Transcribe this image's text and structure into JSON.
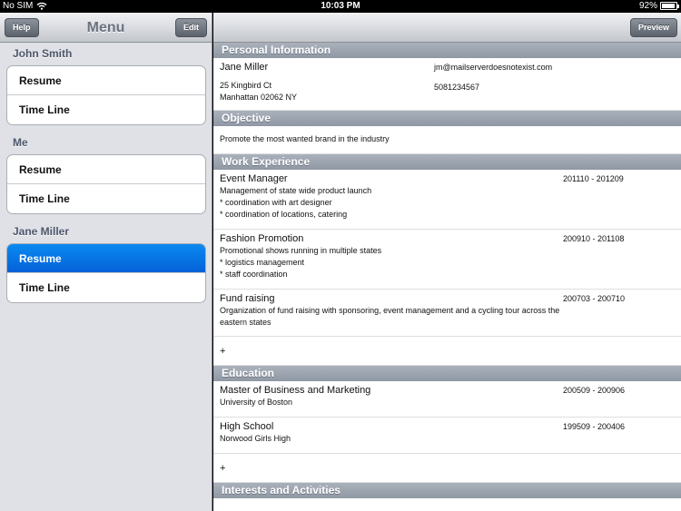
{
  "status_bar": {
    "carrier": "No SIM",
    "time": "10:03 PM",
    "battery": "92%",
    "battery_level": 0.92
  },
  "sidebar": {
    "title": "Menu",
    "help_label": "Help",
    "edit_label": "Edit",
    "groups": [
      {
        "name": "John Smith",
        "items": [
          {
            "label": "Resume"
          },
          {
            "label": "Time Line"
          }
        ]
      },
      {
        "name": "Me",
        "items": [
          {
            "label": "Resume"
          },
          {
            "label": "Time Line"
          }
        ]
      },
      {
        "name": "Jane Miller",
        "items": [
          {
            "label": "Resume"
          },
          {
            "label": "Time Line"
          }
        ]
      }
    ],
    "selected": "Jane Miller / Resume"
  },
  "detail": {
    "preview_label": "Preview",
    "personal": {
      "header": "Personal Information",
      "name": "Jane Miller",
      "email": "jm@mailserverdoesnotexist.com",
      "address1": "25 Kingbird Ct",
      "address2": "Manhattan 02062 NY",
      "phone": "5081234567"
    },
    "objective": {
      "header": "Objective",
      "text": "Promote the most wanted brand in the industry"
    },
    "work": {
      "header": "Work Experience",
      "items": [
        {
          "title": "Event Manager",
          "dates": "201110 - 201209",
          "lines": [
            "Management of state wide product launch",
            "* coordination with art designer",
            "* coordination of locations, catering"
          ]
        },
        {
          "title": "Fashion Promotion",
          "dates": "200910 - 201108",
          "lines": [
            "Promotional shows running in multiple states",
            "* logistics management",
            "* staff coordination"
          ]
        },
        {
          "title": "Fund raising",
          "dates": "200703 - 200710",
          "lines": [
            "Organization of fund raising with sponsoring, event management and a cycling tour across the",
            "eastern states"
          ]
        }
      ],
      "add_label": "+"
    },
    "education": {
      "header": "Education",
      "items": [
        {
          "title": "Master of Business and Marketing",
          "dates": "200509 - 200906",
          "lines": [
            "University of Boston"
          ]
        },
        {
          "title": "High School",
          "dates": "199509 - 200406",
          "lines": [
            "Norwood Girls High"
          ]
        }
      ],
      "add_label": "+"
    },
    "interests": {
      "header": "Interests and Activities"
    }
  }
}
